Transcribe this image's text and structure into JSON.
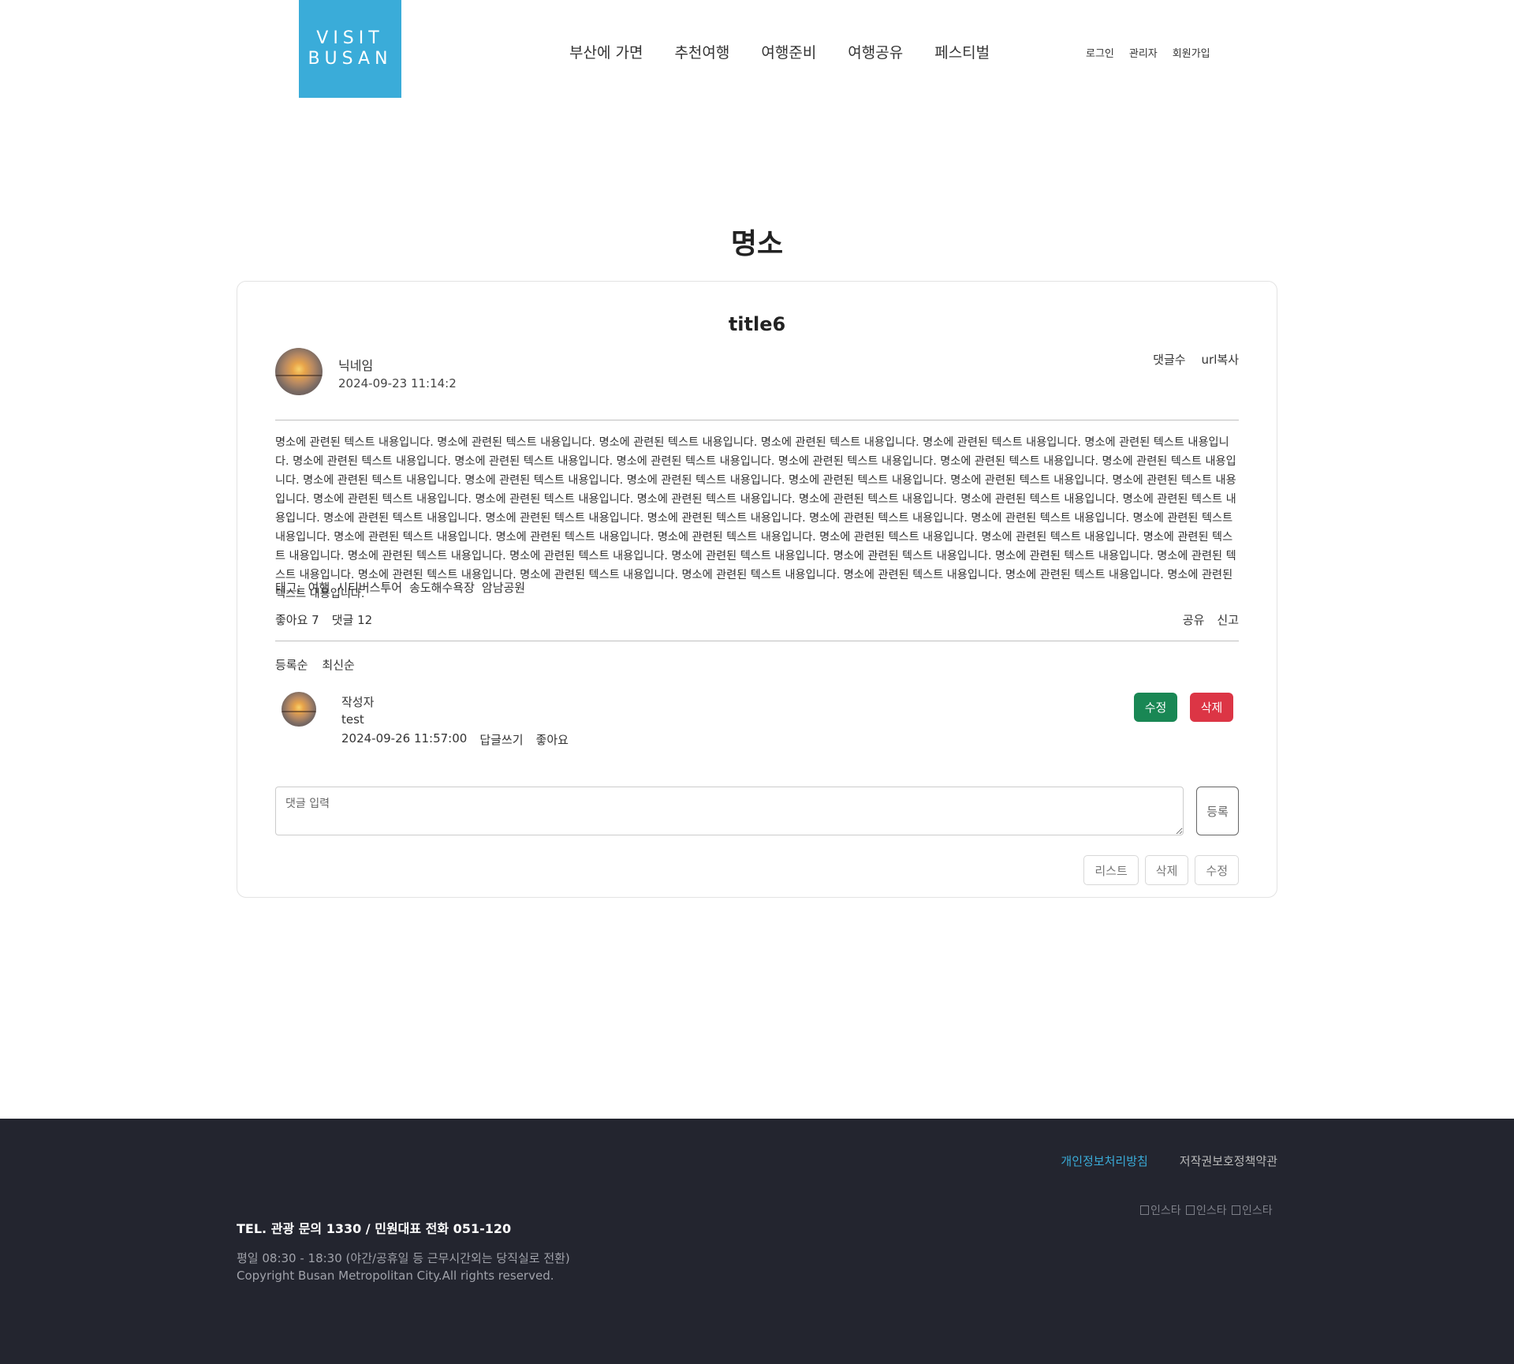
{
  "header": {
    "logo_text": "VISIT\nBUSAN",
    "nav": [
      "부산에 가면",
      "추천여행",
      "여행준비",
      "여행공유",
      "페스티벌"
    ],
    "util": [
      "로그인",
      "관리자",
      "회원가입"
    ]
  },
  "page": {
    "title": "명소"
  },
  "post": {
    "title": "title6",
    "author": "닉네임",
    "date": "2024-09-23 11:14:2",
    "meta_links": [
      "댓글수",
      "url복사"
    ],
    "body": "명소에 관련된 텍스트 내용입니다. 명소에 관련된 텍스트 내용입니다. 명소에 관련된 텍스트 내용입니다. 명소에 관련된 텍스트 내용입니다. 명소에 관련된 텍스트 내용입니다. 명소에 관련된 텍스트 내용입니다. 명소에 관련된 텍스트 내용입니다. 명소에 관련된 텍스트 내용입니다. 명소에 관련된 텍스트 내용입니다. 명소에 관련된 텍스트 내용입니다. 명소에 관련된 텍스트 내용입니다. 명소에 관련된 텍스트 내용입니다. 명소에 관련된 텍스트 내용입니다. 명소에 관련된 텍스트 내용입니다. 명소에 관련된 텍스트 내용입니다. 명소에 관련된 텍스트 내용입니다. 명소에 관련된 텍스트 내용입니다. 명소에 관련된 텍스트 내용입니다. 명소에 관련된 텍스트 내용입니다. 명소에 관련된 텍스트 내용입니다. 명소에 관련된 텍스트 내용입니다. 명소에 관련된 텍스트 내용입니다. 명소에 관련된 텍스트 내용입니다. 명소에 관련된 텍스트 내용입니다. 명소에 관련된 텍스트 내용입니다. 명소에 관련된 텍스트 내용입니다. 명소에 관련된 텍스트 내용입니다. 명소에 관련된 텍스트 내용입니다. 명소에 관련된 텍스트 내용입니다. 명소에 관련된 텍스트 내용입니다. 명소에 관련된 텍스트 내용입니다. 명소에 관련된 텍스트 내용입니다. 명소에 관련된 텍스트 내용입니다. 명소에 관련된 텍스트 내용입니다. 명소에 관련된 텍스트 내용입니다. 명소에 관련된 텍스트 내용입니다. 명소에 관련된 텍스트 내용입니다. 명소에 관련된 텍스트 내용입니다. 명소에 관련된 텍스트 내용입니다. 명소에 관련된 텍스트 내용입니다. 명소에 관련된 텍스트 내용입니다. 명소에 관련된 텍스트 내용입니다. 명소에 관련된 텍스트 내용입니다. 명소에 관련된 텍스트 내용입니다. 명소에 관련된 텍스트 내용입니다. 명소에 관련된 텍스트 내용입니다. 명소에 관련된 텍스트 내용입니다. 명소에 관련된 텍스트 내용입니다.",
    "tags_label": "태그:",
    "tags": [
      "여행",
      "시티버스투어",
      "송도해수욕장",
      "암남공원"
    ],
    "likes": "좋아요 7",
    "comments_count": "댓글 12",
    "actions": [
      "공유",
      "신고"
    ]
  },
  "comments": {
    "sort": [
      "등록순",
      "최신순"
    ],
    "items": [
      {
        "author": "작성자",
        "text": "test",
        "date": "2024-09-26 11:57:00",
        "reply": "답글쓰기",
        "like": "좋아요",
        "edit": "수정",
        "delete": "삭제"
      }
    ],
    "input_placeholder": "댓글 입력",
    "submit": "등록"
  },
  "bottom_buttons": [
    "리스트",
    "삭제",
    "수정"
  ],
  "footer": {
    "privacy": "개인정보처리방침",
    "copyright_policy": "저작권보호정책약관",
    "sns": [
      "인스타",
      "인스타",
      "인스타"
    ],
    "tel": "TEL. 관광 문의 1330 / 민원대표 전화 051-120",
    "hours": "평일 08:30 - 18:30 (야간/공휴일 등 근무시간외는 당직실로 전환)",
    "copyright": "Copyright Busan Metropolitan City.All rights reserved."
  },
  "colors": {
    "brand": "#3aacd9",
    "footer_bg": "#23252f",
    "edit_button": "#198754",
    "delete_button": "#dc3545"
  }
}
